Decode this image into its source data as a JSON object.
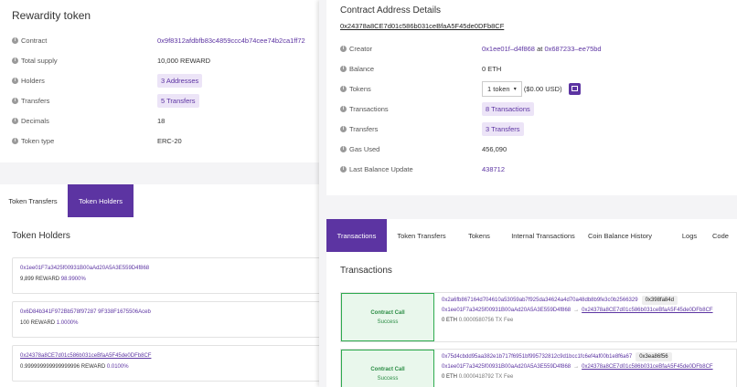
{
  "token": {
    "title": "Rewardity token",
    "rows": [
      {
        "label": "Contract",
        "value": "0x9f8312afdbfb83c4859ccc4b74cee74b2ca1ff72"
      },
      {
        "label": "Total supply",
        "value": "10,000 REWARD"
      },
      {
        "label": "Holders",
        "value": "3 Addresses"
      },
      {
        "label": "Transfers",
        "value": "5 Transfers"
      },
      {
        "label": "Decimals",
        "value": "18"
      },
      {
        "label": "Token type",
        "value": "ERC-20"
      }
    ]
  },
  "left_tabs": [
    "Token Transfers",
    "Token Holders"
  ],
  "holders": {
    "title": "Token Holders",
    "items": [
      {
        "address": "0x1ee01F7a3425f00931B00aAd20A5A3E559D4f868",
        "amount": "9,899 REWARD",
        "percent": "98.9900%"
      },
      {
        "address": "0x6D84b341F972Bb578f97287 9F338F1675506Aceb",
        "amount": "100 REWARD",
        "percent": "1.0000%"
      },
      {
        "address": "0x24378a8CE7d01c586b031ceBfaA5F45de0DFb8CF",
        "amount": "0.999999999999999996 REWARD",
        "percent": "0.0100%"
      }
    ]
  },
  "contract": {
    "title": "Contract Address Details",
    "address": "0x24378a8CE7d01c586b031ceBfaA5F45de0DFb8CF",
    "creator_label": "Creator",
    "creator_addr": "0x1ee01f–d4f868",
    "creator_at": "at",
    "creator_tx": "0x687233–ee75bd",
    "balance_label": "Balance",
    "balance_value": "0 ETH",
    "tokens_label": "Tokens",
    "tokens_select": "1 token",
    "tokens_usd": "($0.00 USD)",
    "transactions_label": "Transactions",
    "transactions_value": "8 Transactions",
    "transfers_label": "Transfers",
    "transfers_value": "3 Transfers",
    "gas_label": "Gas Used",
    "gas_value": "456,090",
    "last_label": "Last Balance Update",
    "last_value": "438712"
  },
  "right_tabs": [
    "Transactions",
    "Token Transfers",
    "Tokens",
    "Internal Transactions",
    "Coin Balance History",
    "Logs",
    "Code"
  ],
  "transactions": {
    "title": "Transactions",
    "items": [
      {
        "status_title": "Contract Call",
        "status": "Success",
        "hash": "0x2a6fb867164d704610a53059ab7f925da34624a4d70a48db8b9fe3c0b2566329",
        "method": "0x398fa84d",
        "from": "0x1ee01F7a3425f00931B00aAd20A5A3E559D4f868",
        "arrow": "→",
        "to": "0x24378a8CE7d01c586b031ceBfaA5F45de0DFb8CF",
        "value": "0 ETH",
        "fee": "0.0000580756",
        "fee_label": "TX Fee"
      },
      {
        "status_title": "Contract Call",
        "status": "Success",
        "hash": "0x75d4cbdd95aa382e1b717f6951bf995732812c9d1bcc1fc6ef4af00b1e8f6a67",
        "method": "0x3ea86f56",
        "from": "0x1ee01F7a3425f00931B00aAd20A5A3E559D4f868",
        "arrow": "→",
        "to": "0x24378a8CE7d01c586b031ceBfaA5F45de0DFb8CF",
        "value": "0 ETH",
        "fee": "0.0000418792",
        "fee_label": "TX Fee"
      }
    ]
  },
  "colors": {
    "accent": "#5c34a2",
    "success": "#2eaa4f"
  }
}
